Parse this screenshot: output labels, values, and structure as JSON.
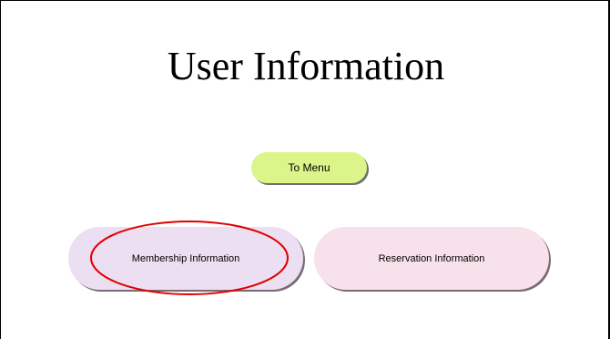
{
  "page": {
    "title": "User Information"
  },
  "buttons": {
    "to_menu": {
      "label": "To Menu",
      "color": "#dcf58a"
    },
    "membership": {
      "label": "Membership Information",
      "color": "#eddff2"
    },
    "reservation": {
      "label": "Reservation Information",
      "color": "#f7e1ea"
    }
  },
  "annotation": {
    "highlight_color": "#e00000"
  }
}
